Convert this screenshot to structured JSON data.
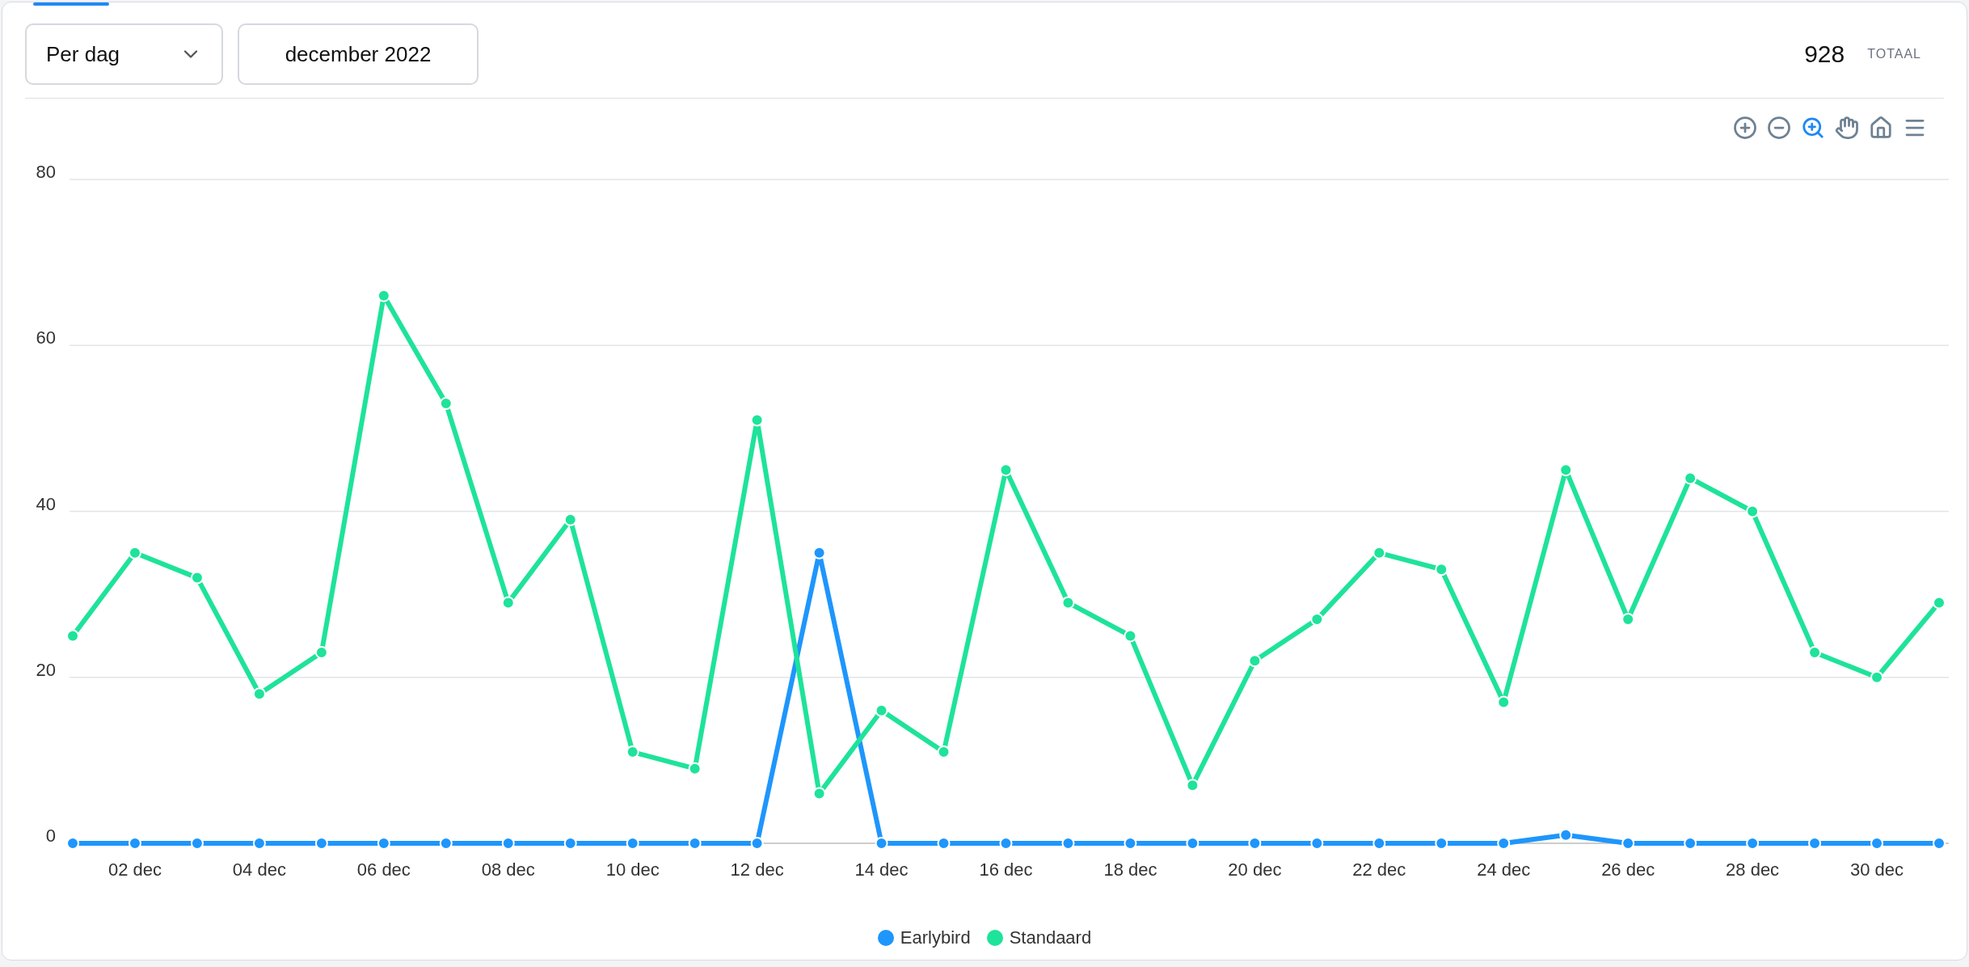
{
  "controls": {
    "period": {
      "value": "Per dag"
    },
    "month": {
      "label": "december 2022"
    }
  },
  "total": {
    "value": "928",
    "label": "TOTAAL"
  },
  "toolbar": [
    {
      "kind": "zoom-in",
      "selected": false
    },
    {
      "kind": "zoom-out",
      "selected": false
    },
    {
      "kind": "zoom",
      "selected": true
    },
    {
      "kind": "pan",
      "selected": false
    },
    {
      "kind": "home",
      "selected": false
    },
    {
      "kind": "menu",
      "selected": false
    }
  ],
  "chart_data": {
    "type": "line",
    "categories": [
      null,
      "02 dec",
      null,
      "04 dec",
      null,
      "06 dec",
      null,
      "08 dec",
      null,
      "10 dec",
      null,
      "12 dec",
      null,
      "14 dec",
      null,
      "16 dec",
      null,
      "18 dec",
      null,
      "20 dec",
      null,
      "22 dec",
      null,
      "24 dec",
      null,
      "26 dec",
      null,
      "28 dec",
      null,
      "30 dec",
      null
    ],
    "ylim": [
      0,
      80
    ],
    "grid": true,
    "yticks": [
      0,
      20,
      40,
      60,
      80
    ],
    "series": [
      {
        "name": "Earlybird",
        "color": "#1e96fc",
        "marker": true,
        "values": [
          0,
          0,
          0,
          0,
          0,
          0,
          0,
          0,
          0,
          0,
          0,
          0,
          35,
          0,
          0,
          0,
          0,
          0,
          0,
          0,
          0,
          0,
          0,
          0,
          1,
          0,
          0,
          0,
          0,
          0,
          0
        ]
      },
      {
        "name": "Standaard",
        "color": "#1ee39a",
        "marker": true,
        "values": [
          25,
          35,
          32,
          18,
          23,
          66,
          53,
          29,
          39,
          11,
          9,
          51,
          6,
          16,
          11,
          45,
          29,
          25,
          7,
          22,
          27,
          35,
          33,
          17,
          45,
          27,
          44,
          40,
          23,
          20,
          29
        ]
      }
    ]
  }
}
